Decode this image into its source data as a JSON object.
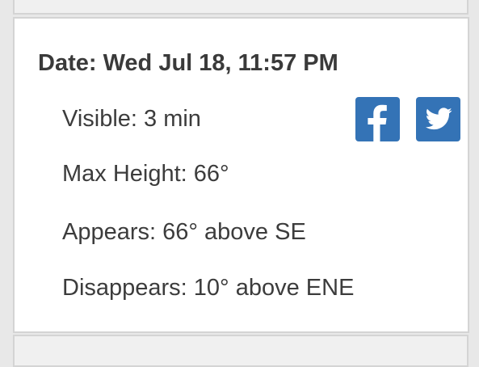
{
  "sighting": {
    "date": "Date: Wed Jul 18, 11:57 PM",
    "visible": "Visible: 3 min",
    "max_height": "Max Height: 66°",
    "appears": "Appears: 66° above SE",
    "disappears": "Disappears: 10° above ENE"
  },
  "share": {
    "facebook_icon": "facebook-icon",
    "twitter_icon": "twitter-icon",
    "brand_color": "#3473b6"
  }
}
